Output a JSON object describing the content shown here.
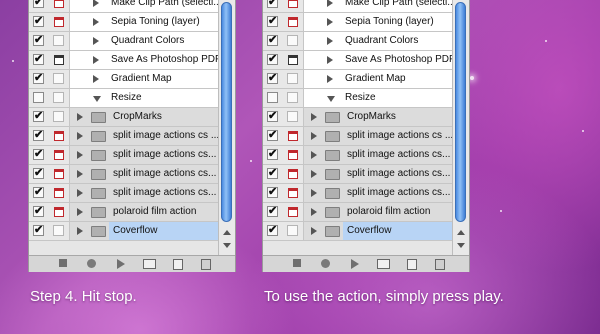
{
  "panels": [
    {
      "rows": [
        {
          "kind": "item",
          "checked": true,
          "dialog": "red",
          "label": "Make Clip Path (selecti..."
        },
        {
          "kind": "item",
          "checked": true,
          "dialog": "red",
          "label": "Sepia Toning (layer)"
        },
        {
          "kind": "item",
          "checked": true,
          "dialog": "",
          "label": "Quadrant Colors"
        },
        {
          "kind": "item",
          "checked": true,
          "dialog": "dark",
          "label": "Save As Photoshop PDF"
        },
        {
          "kind": "item",
          "checked": true,
          "dialog": "",
          "label": "Gradient Map"
        },
        {
          "kind": "item-open",
          "checked": false,
          "dialog": "",
          "label": "Resize"
        },
        {
          "kind": "folder",
          "checked": true,
          "dialog": "",
          "label": "CropMarks"
        },
        {
          "kind": "folder",
          "checked": true,
          "dialog": "red",
          "label": "split image actions cs ..."
        },
        {
          "kind": "folder",
          "checked": true,
          "dialog": "red",
          "label": "split image actions cs..."
        },
        {
          "kind": "folder",
          "checked": true,
          "dialog": "red",
          "label": "split image actions cs..."
        },
        {
          "kind": "folder",
          "checked": true,
          "dialog": "red",
          "label": "split image actions cs..."
        },
        {
          "kind": "folder",
          "checked": true,
          "dialog": "red",
          "label": "polaroid film action"
        },
        {
          "kind": "folder",
          "checked": true,
          "dialog": "",
          "label": "Coverflow",
          "selected": true
        }
      ]
    },
    {
      "rows": [
        {
          "kind": "item",
          "checked": true,
          "dialog": "red",
          "label": "Make Clip Path (selecti..."
        },
        {
          "kind": "item",
          "checked": true,
          "dialog": "red",
          "label": "Sepia Toning (layer)"
        },
        {
          "kind": "item",
          "checked": true,
          "dialog": "",
          "label": "Quadrant Colors"
        },
        {
          "kind": "item",
          "checked": true,
          "dialog": "dark",
          "label": "Save As Photoshop PDF"
        },
        {
          "kind": "item",
          "checked": true,
          "dialog": "",
          "label": "Gradient Map"
        },
        {
          "kind": "item-open",
          "checked": false,
          "dialog": "",
          "label": "Resize"
        },
        {
          "kind": "folder",
          "checked": true,
          "dialog": "",
          "label": "CropMarks"
        },
        {
          "kind": "folder",
          "checked": true,
          "dialog": "red",
          "label": "split image actions cs ..."
        },
        {
          "kind": "folder",
          "checked": true,
          "dialog": "red",
          "label": "split image actions cs..."
        },
        {
          "kind": "folder",
          "checked": true,
          "dialog": "red",
          "label": "split image actions cs..."
        },
        {
          "kind": "folder",
          "checked": true,
          "dialog": "red",
          "label": "split image actions cs..."
        },
        {
          "kind": "folder",
          "checked": true,
          "dialog": "red",
          "label": "polaroid film action"
        },
        {
          "kind": "folder",
          "checked": true,
          "dialog": "",
          "label": "Coverflow",
          "selected": true
        }
      ]
    }
  ],
  "toolbar_icons": [
    "stop-icon",
    "record-icon",
    "play-icon",
    "new-set-icon",
    "new-action-icon",
    "trash-icon"
  ],
  "captions": {
    "left": "Step 4. Hit stop.",
    "right": "To use the action, simply press play."
  },
  "colors": {
    "selection": "#b8d4f5",
    "scroll_thumb": "#4a8ae0",
    "dialog_red": "#c0282d"
  }
}
